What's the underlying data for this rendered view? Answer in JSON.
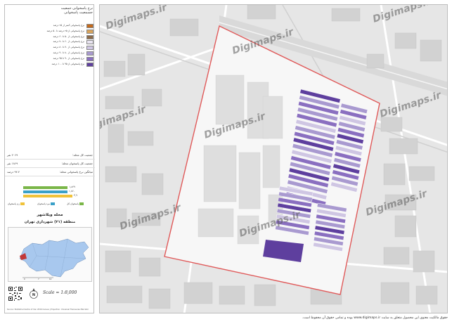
{
  "legend": {
    "title_line1": "نرخ پاسخوانی جمعیت",
    "title_line2": "جسمعیت پاسخوانی",
    "items": [
      {
        "label": "نرخ پاسخوانی کمتر از ۲۵ درصد",
        "color": "#c46a1c"
      },
      {
        "label": "نرخ پاسخوانی از ۲۵ درصد تا ۵۰ درصد",
        "color": "#d9a35a"
      },
      {
        "label": "نرخ پاسخوانی از ۵۰ تا ۶۰ درصد",
        "color": "#8c6b4a"
      },
      {
        "label": "نرخ پاسخوانی از ۶۰ تا ۷۰ درصد",
        "color": "#e9e4f1"
      },
      {
        "label": "نرخ پاسخوانی از ۷۰ تا ۸۰ درصد",
        "color": "#cfc6e3"
      },
      {
        "label": "نرخ پاسخوانی از ۸۰ تا ۹۰ درصد",
        "color": "#a99ad0"
      },
      {
        "label": "نرخ پاسخوانی از ۹۰ تا ۹۵ درصد",
        "color": "#8a6fc0"
      },
      {
        "label": "نرخ پاسخوانی از ۹۵ تا ۱۰۰ درصد",
        "color": "#5e3f9e"
      }
    ]
  },
  "stats": [
    {
      "label": "جمعیت کل محله:",
      "value": "۲۰۶۹ نفر"
    },
    {
      "label": "جمعیت کل پاسخوان محله:",
      "value": "۱۸۶۹ نفر"
    },
    {
      "label": "میانگین نرخ پاسخوانی محله:",
      "value": "۹۲.۲ درصد"
    }
  ],
  "bars": {
    "values": [
      {
        "label": "۱,۸۶۹",
        "value": 1869,
        "color": "#7ab648"
      },
      {
        "label": "۱,۸۶۰",
        "value": 1860,
        "color": "#3aa0c8"
      },
      {
        "label": "۳,۹",
        "value": 2069,
        "color": "#f0c23a"
      }
    ],
    "max": 2069,
    "legend": [
      {
        "label": "پاسخوان کل",
        "color": "#7ab648"
      },
      {
        "label": "مرد پاسخوان",
        "color": "#3aa0c8"
      },
      {
        "label": "زن پاسخوان",
        "color": "#f0c23a"
      }
    ]
  },
  "area": {
    "title": "محله ویلاشهر",
    "subtitle": "منطقه (۲۱) شهرداری تهران"
  },
  "scale": {
    "text": "Scale = 1:8,000"
  },
  "footer_note": "Source: Statistical Centre of Iran 2016 Census | Projection: Universal Transverse Mercator",
  "watermark": "Digimaps.ir",
  "copyright": "حقوق مالکیت معنوی این محصول متعلق به سایت www.digimaps.ir بوده و تمامی حقوق آن محفوظ است.",
  "colors": {
    "boundary": "#e05a5a",
    "map_bg": "#e8e8e8",
    "zone_bg": "#f7f7f7",
    "building": "#d7d7d7"
  }
}
